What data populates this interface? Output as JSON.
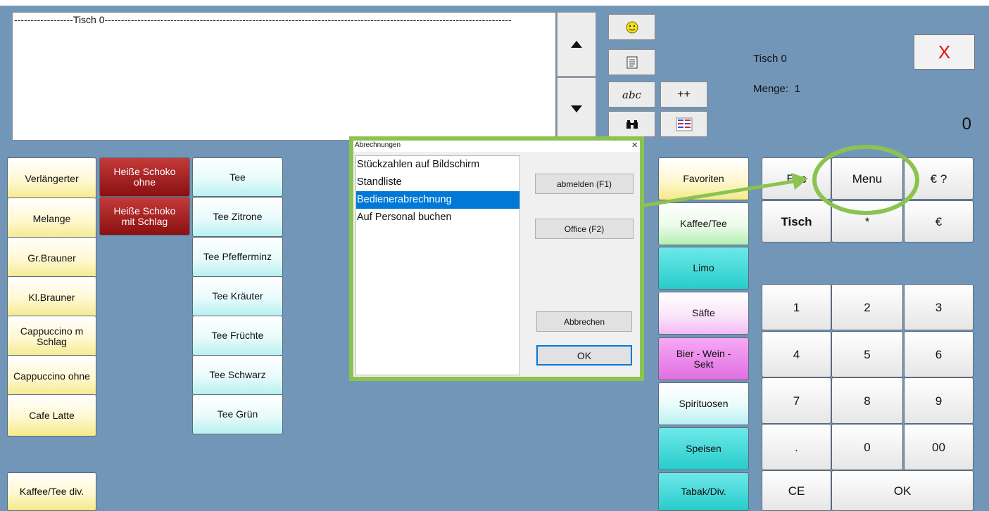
{
  "receipt": {
    "header": "------------------Tisch 0----------------------------------------------------------------------------------------------------------------------------"
  },
  "info": {
    "tisch": "Tisch 0",
    "menge_label": "Menge:",
    "menge_value": "1",
    "total": "0",
    "close": "X"
  },
  "tools": {
    "plus": "++",
    "abc": "abc"
  },
  "left_col1": [
    "Verlängerter",
    "Melange",
    "Gr.Brauner",
    "Kl.Brauner",
    "Cappuccino m Schlag",
    "Cappuccino ohne",
    "Cafe Latte",
    "Kaffee/Tee div."
  ],
  "left_col2": [
    "Heiße Schoko ohne",
    "Heiße Schoko mit Schlag"
  ],
  "left_col3": [
    "Tee",
    "Tee Zitrone",
    "Tee Pfefferminz",
    "Tee Kräuter",
    "Tee Früchte",
    "Tee Schwarz",
    "Tee Grün"
  ],
  "categories": [
    "Favoriten",
    "Kaffee/Tee",
    "Limo",
    "Säfte",
    "Bier - Wein - Sekt",
    "Spirituosen",
    "Speisen",
    "Tabak/Div."
  ],
  "keypad": {
    "esc": "Esc",
    "menu": "Menu",
    "euro_q": "€ ?",
    "tisch": "Tisch",
    "star": "*",
    "euro": "€",
    "n1": "1",
    "n2": "2",
    "n3": "3",
    "n4": "4",
    "n5": "5",
    "n6": "6",
    "n7": "7",
    "n8": "8",
    "n9": "9",
    "dot": ".",
    "n0": "0",
    "n00": "00",
    "ce": "CE",
    "ok": "OK"
  },
  "dialog": {
    "title": "Abrechnungen",
    "close": "×",
    "items": [
      "Stückzahlen auf Bildschirm",
      "Standliste",
      "Bedienerabrechnung",
      "Auf Personal buchen"
    ],
    "selected_index": 2,
    "logout": "abmelden (F1)",
    "office": "Office (F2)",
    "cancel": "Abbrechen",
    "ok": "OK"
  },
  "colors": {
    "background": "#7296b8",
    "highlight": "#8cc350",
    "selection": "#0078d7",
    "close_x": "#e01010"
  }
}
